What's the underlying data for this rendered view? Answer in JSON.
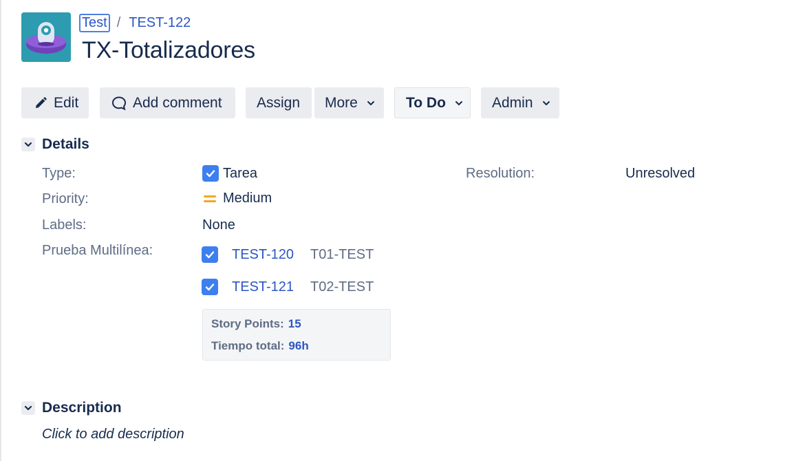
{
  "breadcrumb": {
    "project": "Test",
    "separator": "/",
    "issue_key": "TEST-122"
  },
  "issue": {
    "title": "TX-Totalizadores"
  },
  "toolbar": {
    "edit": "Edit",
    "add_comment": "Add comment",
    "assign": "Assign",
    "more": "More",
    "status": "To Do",
    "admin": "Admin"
  },
  "details": {
    "section_title": "Details",
    "type_label": "Type:",
    "type_value": "Tarea",
    "priority_label": "Priority:",
    "priority_value": "Medium",
    "labels_label": "Labels:",
    "labels_value": "None",
    "resolution_label": "Resolution:",
    "resolution_value": "Unresolved",
    "multiline_label": "Prueba Multilínea:",
    "multiline_items": [
      {
        "key": "TEST-120",
        "summary": "T01-TEST"
      },
      {
        "key": "TEST-121",
        "summary": "T02-TEST"
      }
    ],
    "story_points_label": "Story Points:",
    "story_points_value": "15",
    "total_time_label": "Tiempo total:",
    "total_time_value": "96h"
  },
  "description": {
    "section_title": "Description",
    "placeholder": "Click to add description"
  },
  "colors": {
    "link": "#2b55c4",
    "checkbox": "#3d7ff0",
    "priority_medium": "#f5a623",
    "button_bg": "#ebecf0"
  }
}
